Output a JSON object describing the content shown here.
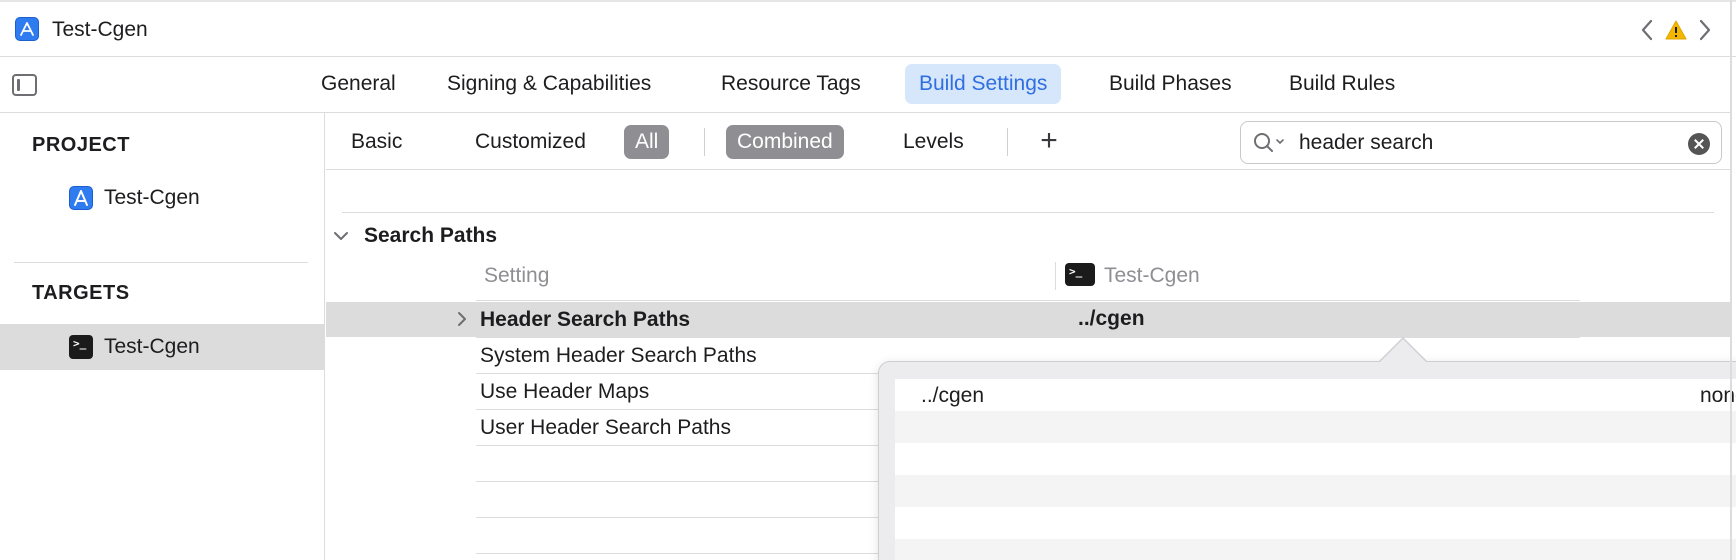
{
  "window": {
    "title": "Test-Cgen"
  },
  "toolbar": {
    "back_icon": "chevron-left-icon",
    "warning_icon": "warning-triangle-icon",
    "forward_icon": "chevron-right-icon"
  },
  "editor_tabs": [
    {
      "label": "General",
      "active": false
    },
    {
      "label": "Signing & Capabilities",
      "active": false
    },
    {
      "label": "Resource Tags",
      "active": false
    },
    {
      "label": "Build Settings",
      "active": true
    },
    {
      "label": "Build Phases",
      "active": false
    },
    {
      "label": "Build Rules",
      "active": false
    }
  ],
  "sidebar": {
    "project_header": "PROJECT",
    "project_item": "Test-Cgen",
    "targets_header": "TARGETS",
    "target_item": "Test-Cgen"
  },
  "filters": {
    "basic": "Basic",
    "customized": "Customized",
    "all": "All",
    "combined": "Combined",
    "levels": "Levels",
    "add": "+"
  },
  "search": {
    "value": "header search",
    "placeholder": ""
  },
  "settings": {
    "group_title": "Search Paths",
    "col_setting": "Setting",
    "col_target": "Test-Cgen",
    "rows": [
      {
        "name": "Header Search Paths",
        "value": "../cgen",
        "bold": true,
        "selected": true
      },
      {
        "name": "System Header Search Paths",
        "value": ""
      },
      {
        "name": "Use Header Maps",
        "value": ""
      },
      {
        "name": "User Header Search Paths",
        "value": ""
      }
    ]
  },
  "popover": {
    "path": "../cgen",
    "recursion": "non-recursive"
  },
  "colors": {
    "accent": "#2f6fe0",
    "active_tab_bg": "#d6e6fb",
    "filter_on_bg": "#8e8e93",
    "selection_bg": "#dcdcdc",
    "warning": "#f5b800"
  }
}
